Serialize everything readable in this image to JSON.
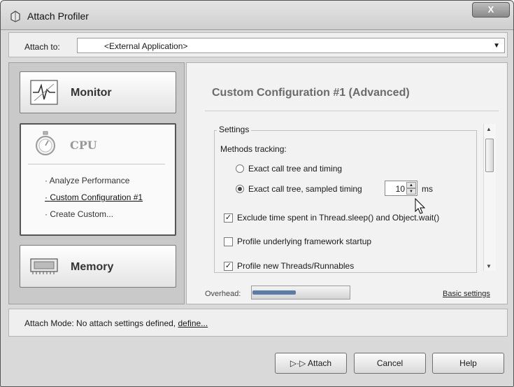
{
  "window": {
    "title": "Attach Profiler",
    "close_label": "X"
  },
  "attach_to": {
    "label": "Attach to:",
    "value": "<External Application>"
  },
  "left_nav": {
    "monitor": {
      "label": "Monitor",
      "icon": "monitor-icon"
    },
    "cpu": {
      "label": "CPU",
      "icon": "stopwatch-icon",
      "items": [
        "Analyze Performance",
        "Custom Configuration #1",
        "Create Custom..."
      ],
      "active_index": 1
    },
    "memory": {
      "label": "Memory",
      "icon": "memory-chip-icon"
    }
  },
  "config": {
    "title": "Custom Configuration #1 (Advanced)",
    "settings_legend": "Settings",
    "methods_label": "Methods tracking:",
    "radio_exact": "Exact call tree and timing",
    "radio_sampled": "Exact call tree, sampled timing",
    "sample_value": "10",
    "sample_unit": "ms",
    "check_exclude": "Exclude time spent in Thread.sleep() and Object.wait()",
    "check_startup": "Profile underlying framework startup",
    "check_threads": "Profile new Threads/Runnables",
    "overhead_label": "Overhead:",
    "overhead_level": 0.45,
    "basic_settings": "Basic settings"
  },
  "attach_mode": {
    "prefix": "Attach Mode:  No attach settings defined,",
    "link": "define..."
  },
  "buttons": {
    "attach": "▷·▷ Attach",
    "cancel": "Cancel",
    "help": "Help"
  },
  "colors": {
    "accent": "#5b7da5",
    "title_gray": "#6b6b6b"
  }
}
